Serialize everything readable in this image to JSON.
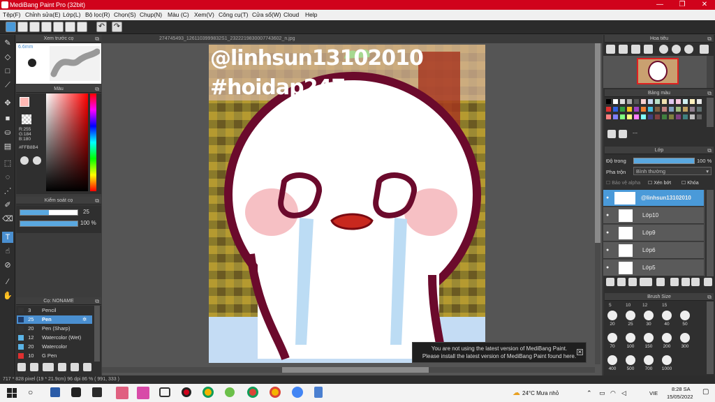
{
  "window": {
    "title": "MediBang Paint Pro (32bit)"
  },
  "menu": [
    "Tệp(F)",
    "Chỉnh sửa(E)",
    "Lớp(L)",
    "Bộ lọc(R)",
    "Chọn(S)",
    "Chụp(N)",
    "Màu (C)",
    "Xem(V)",
    "Công cụ(T)",
    "Cửa sổ(W)",
    "Cloud",
    "Help"
  ],
  "canvas": {
    "filename": "274745493_1261103999832S1_2322219830007743602_n.jpg",
    "overlay_line1": "@linhsun13102010",
    "overlay_line2": "#hoidap247"
  },
  "preview_panel": {
    "title": "Xem trước cọ",
    "size": "6.6mm"
  },
  "color_panel": {
    "title": "Màu",
    "r": "R:255",
    "g": "G:184",
    "b": "B:180",
    "hex": "#FFB8B4"
  },
  "brush_control": {
    "title": "Kiểm soát cọ",
    "size_value": "25",
    "opacity_value": "100 %"
  },
  "brush_panel": {
    "title": "Cọ: NONAME",
    "items": [
      {
        "size": "3",
        "name": "Pencil",
        "color": "#333333"
      },
      {
        "size": "25",
        "name": "Pen",
        "color": "#1f3a66",
        "selected": true
      },
      {
        "size": "20",
        "name": "Pen (Sharp)",
        "color": "#333333"
      },
      {
        "size": "12",
        "name": "Watercolor (Wet)",
        "color": "#5ab3e6"
      },
      {
        "size": "20",
        "name": "Watercolor",
        "color": "#5ab3e6"
      },
      {
        "size": "10",
        "name": "G Pen",
        "color": "#e03030"
      }
    ]
  },
  "navigator": {
    "title": "Hoa tiêu"
  },
  "palette": {
    "title": "Bảng màu",
    "extra": "---"
  },
  "layers": {
    "title": "Lớp",
    "opacity_label": "Độ trong",
    "opacity_value": "100 %",
    "blend_label": "Pha trộn",
    "blend_value": "Bình thường",
    "protect_alpha": "Bảo vệ alpha",
    "clipping": "Xén bớt",
    "lock": "Khóa",
    "items": [
      "@linhsun13102010",
      "Lớp10",
      "Lớp9",
      "Lớp6",
      "Lớp5"
    ]
  },
  "brush_size": {
    "title": "Brush Size",
    "sizes_row1": [
      "5",
      "10",
      "12",
      "15"
    ],
    "sizes_row2": [
      "20",
      "25",
      "30",
      "40",
      "50"
    ],
    "sizes_row3": [
      "70",
      "100",
      "150",
      "200",
      "300"
    ],
    "sizes_row4": [
      "400",
      "500",
      "700",
      "1000"
    ]
  },
  "notice": {
    "line1": "You are not using the latest version of MediBang Paint.",
    "line2": "Please install the latest version of MediBang Paint found here."
  },
  "status": {
    "text": "717 * 828 pixel  (19 * 21.9cm)  96 dpi  86 %  ( 991, 333 )"
  },
  "taskbar": {
    "weather": "24°C  Mưa nhỏ",
    "lang": "VIE",
    "time": "8:28 SA",
    "date": "15/05/2022"
  }
}
